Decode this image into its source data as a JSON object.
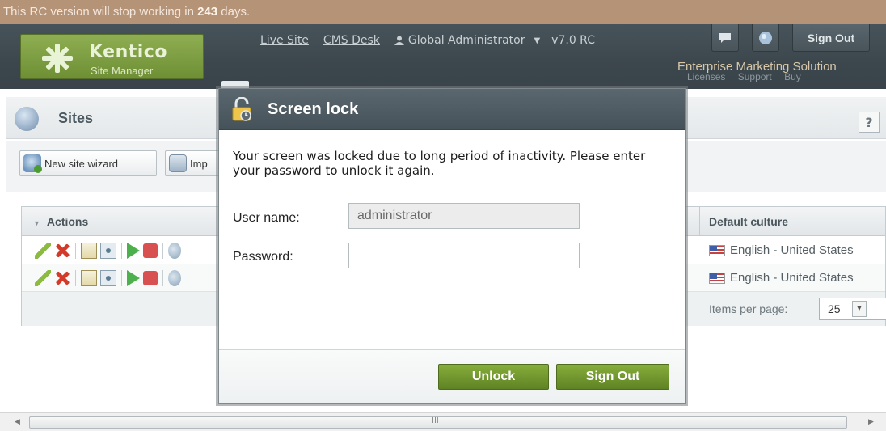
{
  "banner": {
    "prefix": "This RC version will stop working in ",
    "days": "243",
    "suffix": " days."
  },
  "header": {
    "logo_name": "Kentico",
    "logo_sub": "Site Manager",
    "nav": {
      "live_site": "Live Site",
      "cms_desk": "CMS Desk",
      "user": "Global Administrator",
      "version": "v7.0 RC"
    },
    "sign_out": "Sign Out",
    "edition": "Enterprise Marketing Solution",
    "edition_links": [
      "Licenses",
      "Support",
      "Buy"
    ]
  },
  "page": {
    "title": "Sites",
    "help": "?",
    "toolbar": {
      "new_site_wizard": "New site wizard",
      "import": "Imp"
    },
    "grid": {
      "col_actions": "Actions",
      "col_culture": "Default culture",
      "rows": [
        {
          "culture": "English - United States"
        },
        {
          "culture": "English - United States"
        }
      ],
      "pager_label": "Items per page:",
      "pager_value": "25"
    },
    "scroll_grip": "III"
  },
  "dialog": {
    "title": "Screen lock",
    "message": "Your screen was locked due to long period of inactivity. Please enter your password to unlock it again.",
    "user_label": "User name:",
    "user_value": "administrator",
    "password_label": "Password:",
    "password_value": "",
    "unlock_label": "Unlock",
    "signout_label": "Sign Out"
  },
  "colors": {
    "brand_green": "#6f8f35",
    "header_dark": "#3c474d",
    "banner": "#b49377",
    "button_green": "#6f9530"
  }
}
